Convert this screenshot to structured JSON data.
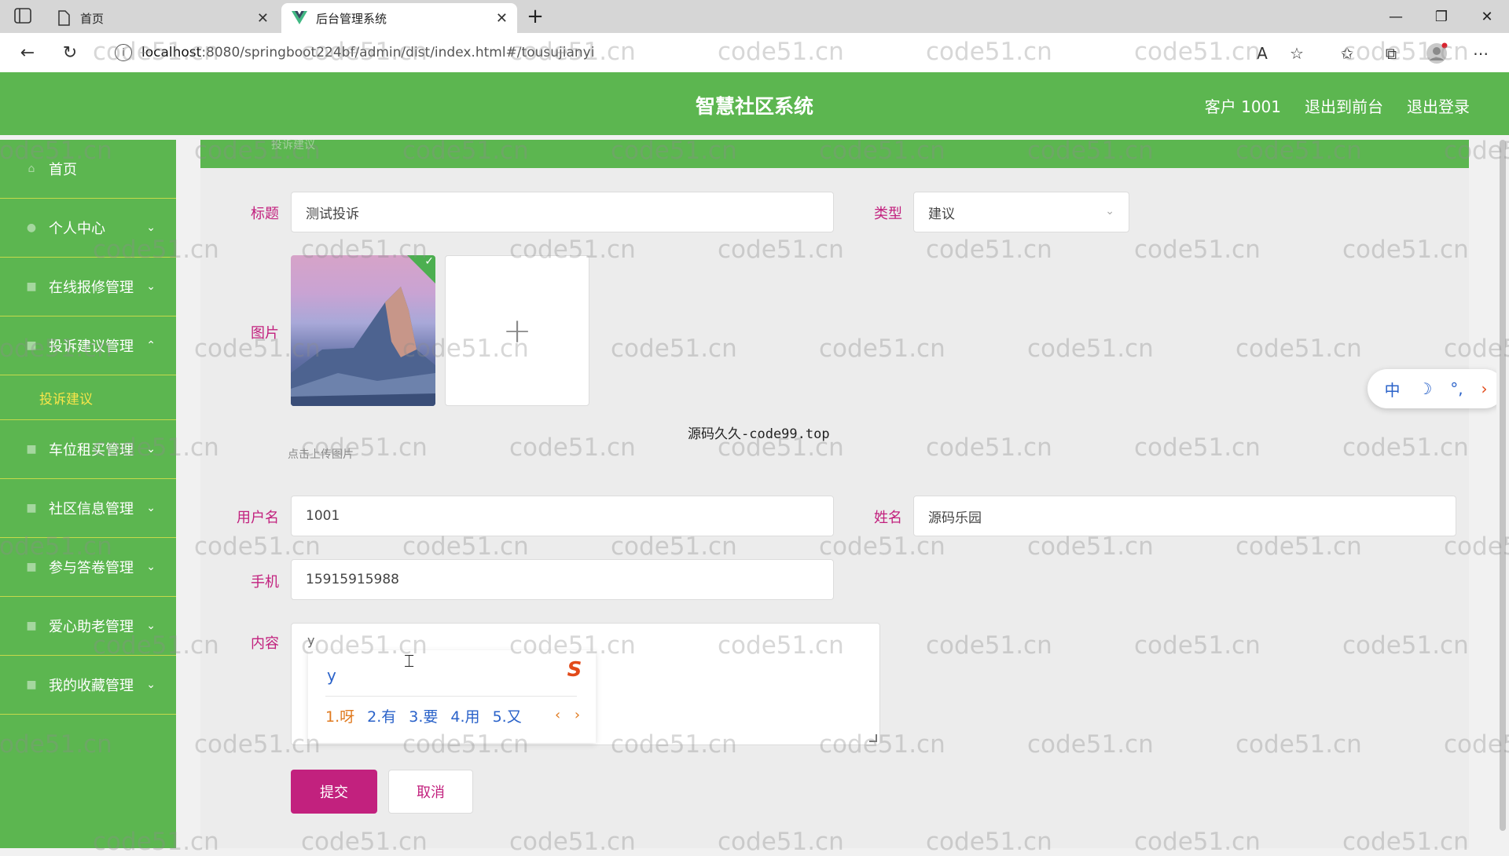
{
  "browser": {
    "tabs": [
      {
        "label": "首页",
        "active": false
      },
      {
        "label": "后台管理系统",
        "active": true
      }
    ],
    "url_host": "localhost",
    "url_rest": ":8080/springboot224bf/admin/dist/index.html#/tousujianyi"
  },
  "header": {
    "title": "智慧社区系统",
    "user": "客户 1001",
    "to_front": "退出到前台",
    "logout": "退出登录",
    "color": "#5cb650"
  },
  "sidebar": {
    "items": [
      {
        "label": "首页",
        "icon": "home-icon",
        "chevron": ""
      },
      {
        "label": "个人中心",
        "icon": "user-icon",
        "chevron": "⌄"
      },
      {
        "label": "在线报修管理",
        "icon": "wrench-icon",
        "chevron": "⌄"
      },
      {
        "label": "投诉建议管理",
        "icon": "document-icon",
        "chevron": "⌃"
      },
      {
        "label": "车位租买管理",
        "icon": "car-icon",
        "chevron": "⌄"
      },
      {
        "label": "社区信息管理",
        "icon": "info-icon",
        "chevron": "⌄"
      },
      {
        "label": "参与答卷管理",
        "icon": "survey-icon",
        "chevron": "⌄"
      },
      {
        "label": "爱心助老管理",
        "icon": "heart-icon",
        "chevron": "⌄"
      },
      {
        "label": "我的收藏管理",
        "icon": "star-icon",
        "chevron": "⌄"
      }
    ],
    "sub_item": "投诉建议"
  },
  "breadcrumb": "投诉建议",
  "form": {
    "title_label": "标题",
    "title_value": "测试投诉",
    "type_label": "类型",
    "type_value": "建议",
    "image_label": "图片",
    "upload_tip": "点击上传图片",
    "username_label": "用户名",
    "username_value": "1001",
    "name_label": "姓名",
    "name_value": "源码乐园",
    "phone_label": "手机",
    "phone_value": "15915915988",
    "content_label": "内容",
    "content_value": "y",
    "submit": "提交",
    "cancel": "取消"
  },
  "center_watermark": "源码久久-code99.top",
  "ime": {
    "input": "y",
    "candidates": [
      "1.呀",
      "2.有",
      "3.要",
      "4.用",
      "5.又"
    ],
    "pager": "‹ ›",
    "toolbar": [
      "中",
      "☽",
      "°,",
      "›"
    ]
  },
  "watermark_text": "code51.cn"
}
